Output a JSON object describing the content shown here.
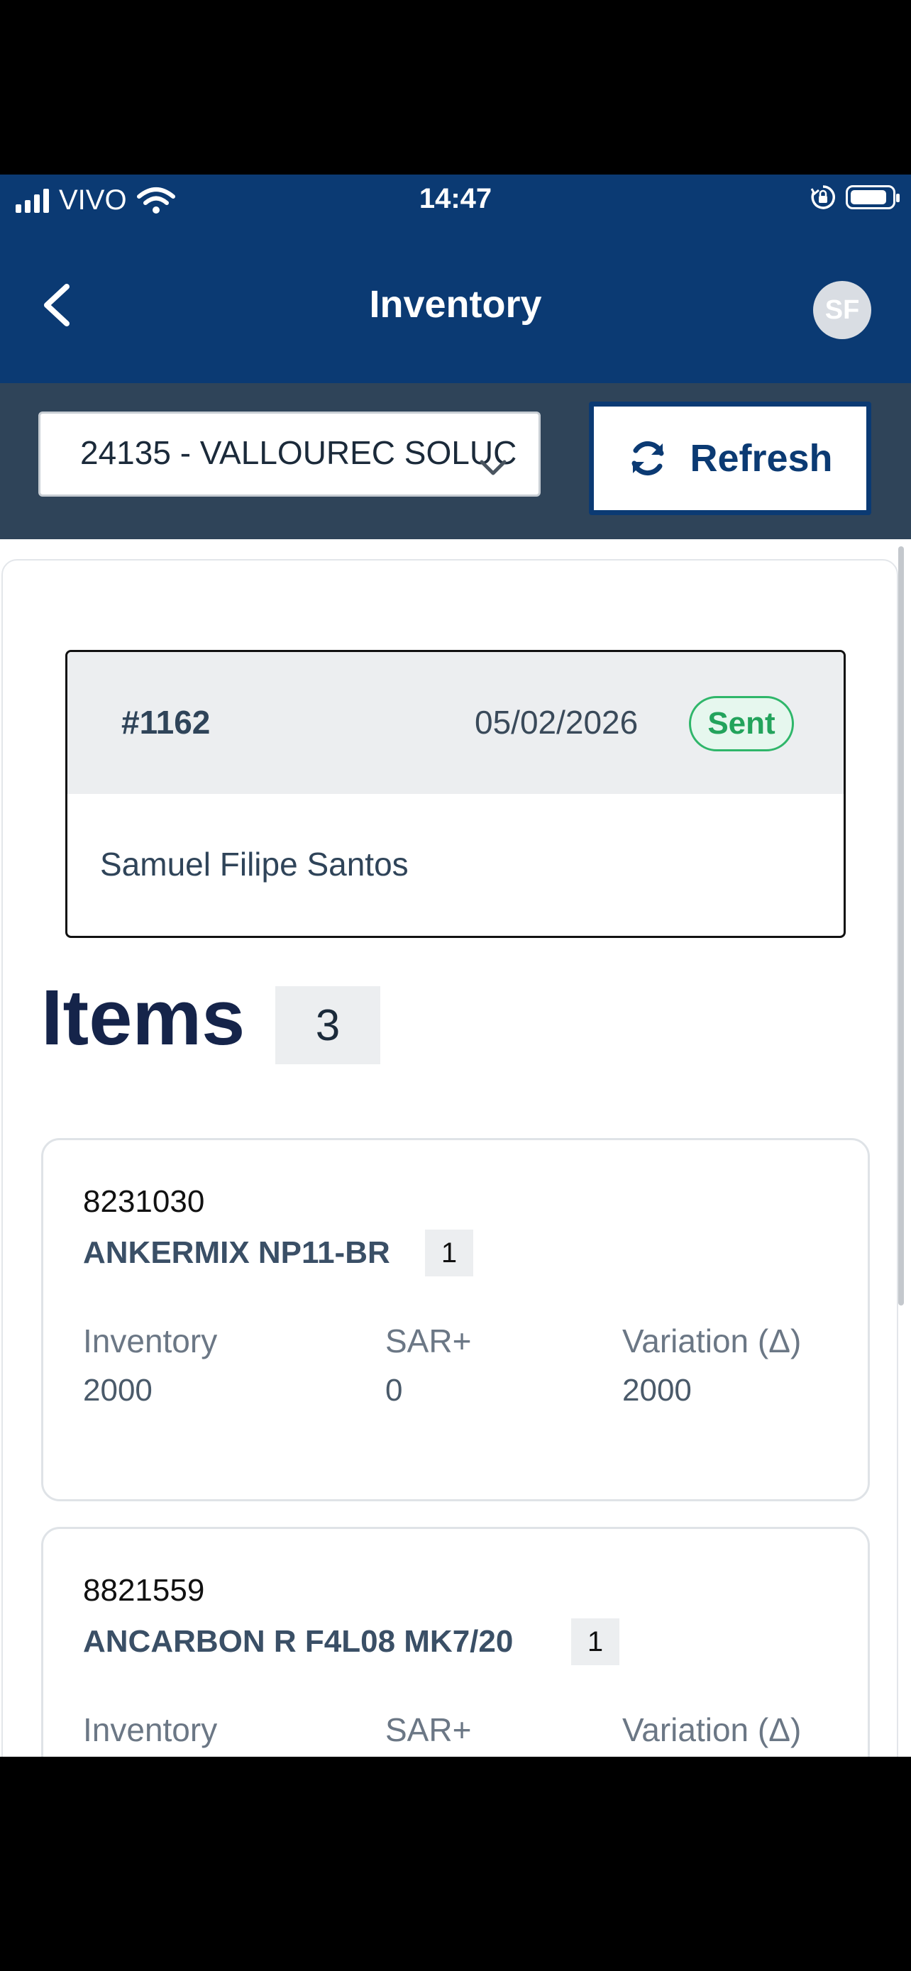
{
  "status_bar": {
    "carrier": "VIVO",
    "time": "14:47"
  },
  "header": {
    "title": "Inventory",
    "avatar_initials": "SF"
  },
  "toolbar": {
    "selected_site": "24135 - VALLOUREC SOLUC",
    "refresh_label": "Refresh"
  },
  "inventory": {
    "id": "#1162",
    "date": "05/02/2026",
    "status": "Sent",
    "user": "Samuel Filipe Santos"
  },
  "items": {
    "heading": "Items",
    "count": "3",
    "list": [
      {
        "code": "8231030",
        "name": "ANKERMIX NP11-BR",
        "qty": "1",
        "inventory_label": "Inventory",
        "inventory_value": "2000",
        "sar_label": "SAR+",
        "sar_value": "0",
        "variation_label": "Variation (Δ)",
        "variation_value": "2000"
      },
      {
        "code": "8821559",
        "name": "ANCARBON R F4L08 MK7/20",
        "qty": "1",
        "inventory_label": "Inventory",
        "sar_label": "SAR+",
        "variation_label": "Variation (Δ)"
      }
    ]
  },
  "colors": {
    "header_blue": "#0b3a73",
    "toolbar_slate": "#2f4459",
    "status_green": "#23a35c"
  },
  "icons": [
    "signal-icon",
    "wifi-icon",
    "orientation-lock-icon",
    "battery-icon",
    "back-chevron-icon",
    "refresh-icon",
    "chevron-down-icon",
    "home-icon",
    "checklist-icon",
    "document-icon"
  ]
}
